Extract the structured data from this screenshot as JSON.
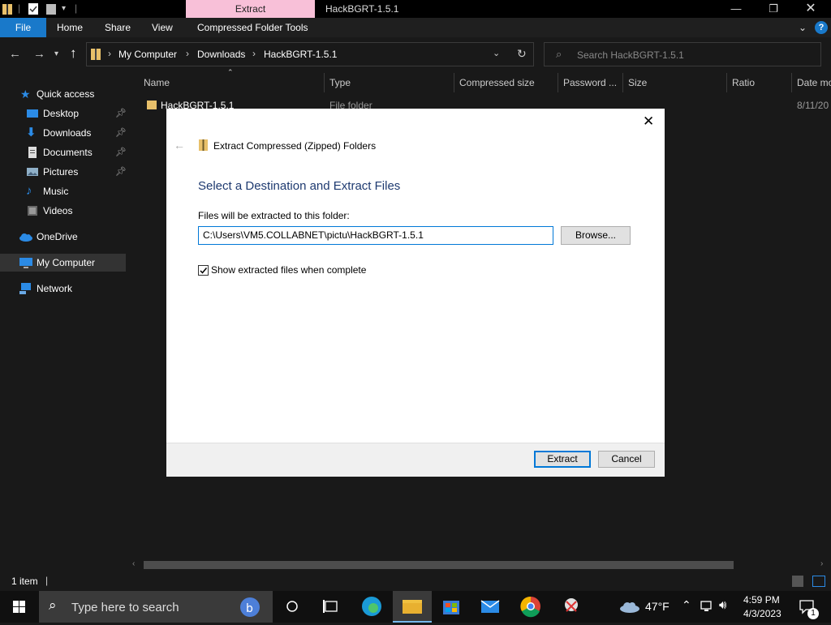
{
  "titlebar": {
    "context_tab": "Extract",
    "window_title": "HackBGRT-1.5.1"
  },
  "ribbon": {
    "tabs": [
      "File",
      "Home",
      "Share",
      "View",
      "Compressed Folder Tools"
    ]
  },
  "address": {
    "crumbs": [
      "My Computer",
      "Downloads",
      "HackBGRT-1.5.1"
    ],
    "search_placeholder": "Search HackBGRT-1.5.1"
  },
  "sidebar": {
    "items": [
      {
        "label": "Quick access",
        "icon": "star-icon"
      },
      {
        "label": "Desktop",
        "icon": "desktop-icon",
        "pinned": true
      },
      {
        "label": "Downloads",
        "icon": "download-icon",
        "pinned": true
      },
      {
        "label": "Documents",
        "icon": "documents-icon",
        "pinned": true
      },
      {
        "label": "Pictures",
        "icon": "pictures-icon",
        "pinned": true
      },
      {
        "label": "Music",
        "icon": "music-icon"
      },
      {
        "label": "Videos",
        "icon": "videos-icon"
      },
      {
        "label": "OneDrive",
        "icon": "cloud-icon"
      },
      {
        "label": "My Computer",
        "icon": "computer-icon",
        "selected": true
      },
      {
        "label": "Network",
        "icon": "network-icon"
      }
    ]
  },
  "columns": [
    "Name",
    "Type",
    "Compressed size",
    "Password ...",
    "Size",
    "Ratio",
    "Date mo"
  ],
  "files": [
    {
      "name": "HackBGRT-1.5.1",
      "type": "File folder",
      "date": "8/11/20"
    }
  ],
  "dialog": {
    "title": "Extract Compressed (Zipped) Folders",
    "heading": "Select a Destination and Extract Files",
    "path_label": "Files will be extracted to this folder:",
    "path_value": "C:\\Users\\VM5.COLLABNET\\pictu\\HackBGRT-1.5.1",
    "browse_label": "Browse...",
    "checkbox_label": "Show extracted files when complete",
    "checkbox_checked": true,
    "extract_label": "Extract",
    "cancel_label": "Cancel"
  },
  "status": {
    "item_count": "1 item"
  },
  "taskbar": {
    "search_placeholder": "Type here to search",
    "weather": "47°F",
    "time": "4:59 PM",
    "date": "4/3/2023",
    "notification_count": "1"
  },
  "colors": {
    "accent": "#1979ca",
    "context_tab": "#f8c0d8",
    "dialog_heading": "#1e3a70"
  }
}
